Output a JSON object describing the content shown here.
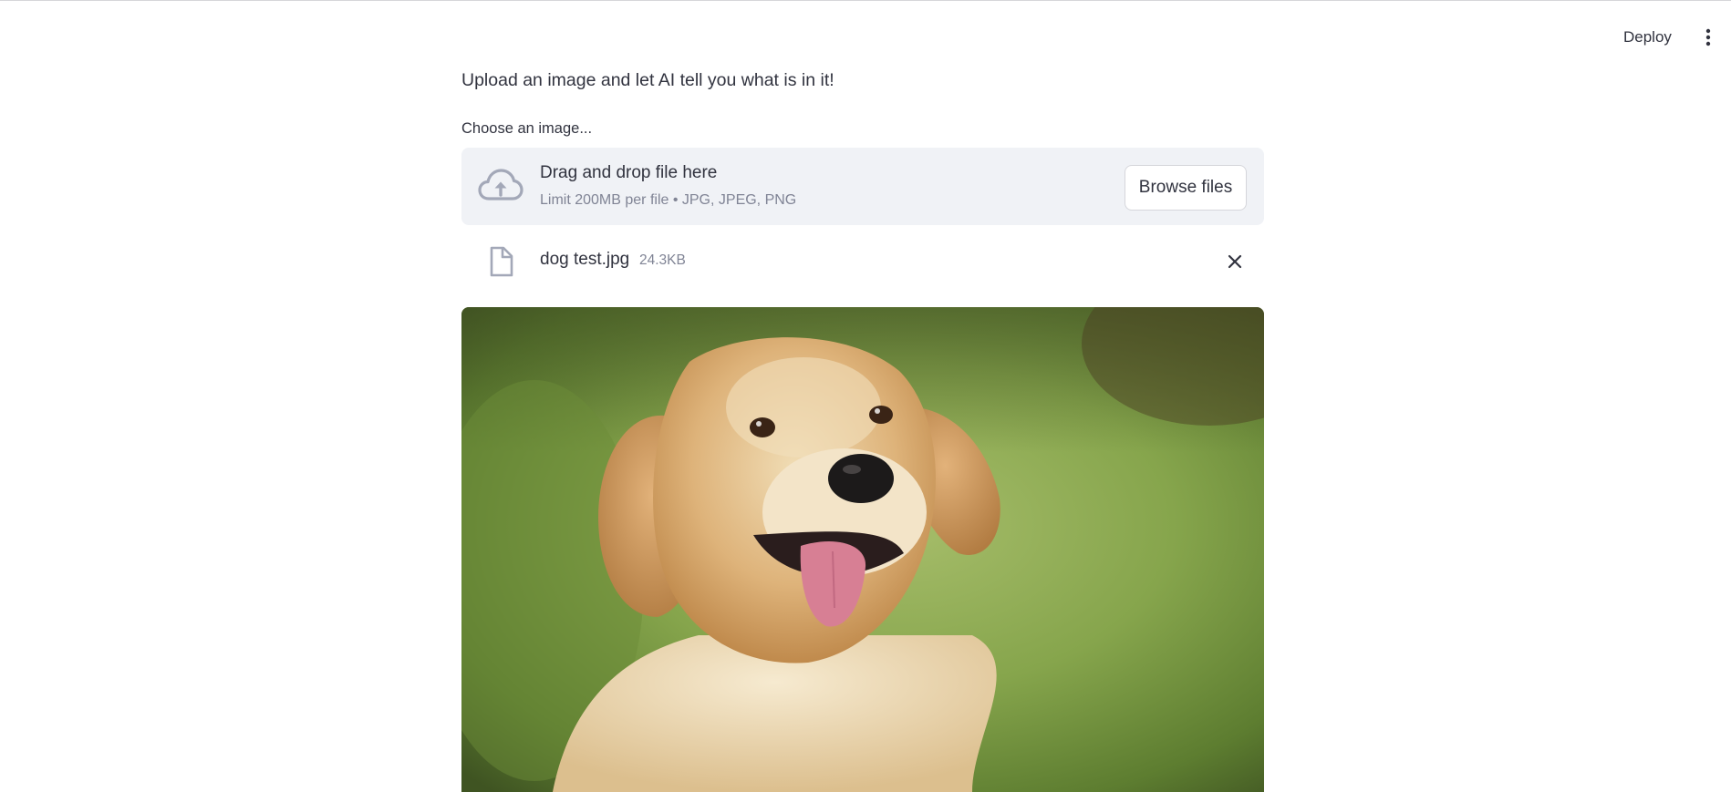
{
  "header": {
    "deploy_label": "Deploy",
    "menu_icon": "vertical-ellipsis-icon"
  },
  "main": {
    "intro_text": "Upload an image and let AI tell you what is in it!",
    "uploader": {
      "label": "Choose an image...",
      "dropzone_title": "Drag and drop file here",
      "dropzone_subtitle": "Limit 200MB per file • JPG, JPEG, PNG",
      "browse_label": "Browse files",
      "upload_icon": "cloud-upload-icon"
    },
    "uploaded_file": {
      "name": "dog test.jpg",
      "size": "24.3KB",
      "file_icon": "file-icon",
      "remove_icon": "close-icon"
    },
    "image": {
      "subject": "golden retriever dog portrait"
    }
  },
  "colors": {
    "dropzone_bg": "#f0f2f6",
    "text": "#31333f",
    "muted_text": "#808495",
    "icon": "#a3a8b8"
  }
}
